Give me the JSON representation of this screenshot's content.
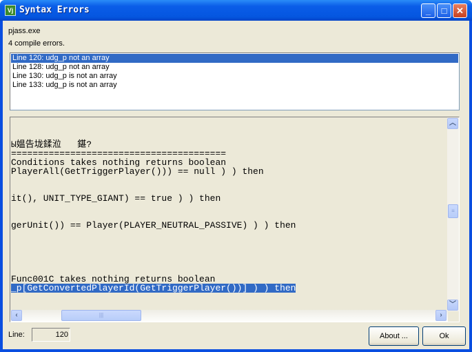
{
  "window": {
    "title": "Syntax Errors",
    "app_icon": "vj-app-icon",
    "minimize": "_",
    "maximize": "□",
    "close": "✕"
  },
  "header": {
    "program": "pjass.exe",
    "summary": "4 compile errors."
  },
  "errors": [
    {
      "text": "Line 120:  udg_p not an array",
      "selected": true
    },
    {
      "text": "Line 128:  udg_p not an array",
      "selected": false
    },
    {
      "text": "Line 130:  udg_p is not an array",
      "selected": false
    },
    {
      "text": "Line 133:  udg_p is not an array",
      "selected": false
    }
  ],
  "code_lines": [
    "",
    "",
    "Ы媪告垅鍒涖   鍖?",
    "========================================",
    "Conditions takes nothing returns boolean",
    "PlayerAll(GetTriggerPlayer())) == null ) ) then",
    "",
    "",
    "it(), UNIT_TYPE_GIANT) == true ) ) then",
    "",
    "",
    "gerUnit()) == Player(PLAYER_NEUTRAL_PASSIVE) ) ) then",
    "",
    "",
    "",
    "",
    "",
    "Func001C takes nothing returns boolean",
    "_p[GetConvertedPlayerId(GetTriggerPlayer())] ) ) then"
  ],
  "selected_code_line": "_p[GetConvertedPlayerId(GetTriggerPlayer())] ) ) then",
  "footer": {
    "line_label": "Line:",
    "line_value": "120",
    "about_label": "About ...",
    "ok_label": "Ok"
  },
  "colors": {
    "selection": "#316ac5",
    "titlebar": "#0a5de8",
    "dialog_bg": "#ece9d8"
  }
}
